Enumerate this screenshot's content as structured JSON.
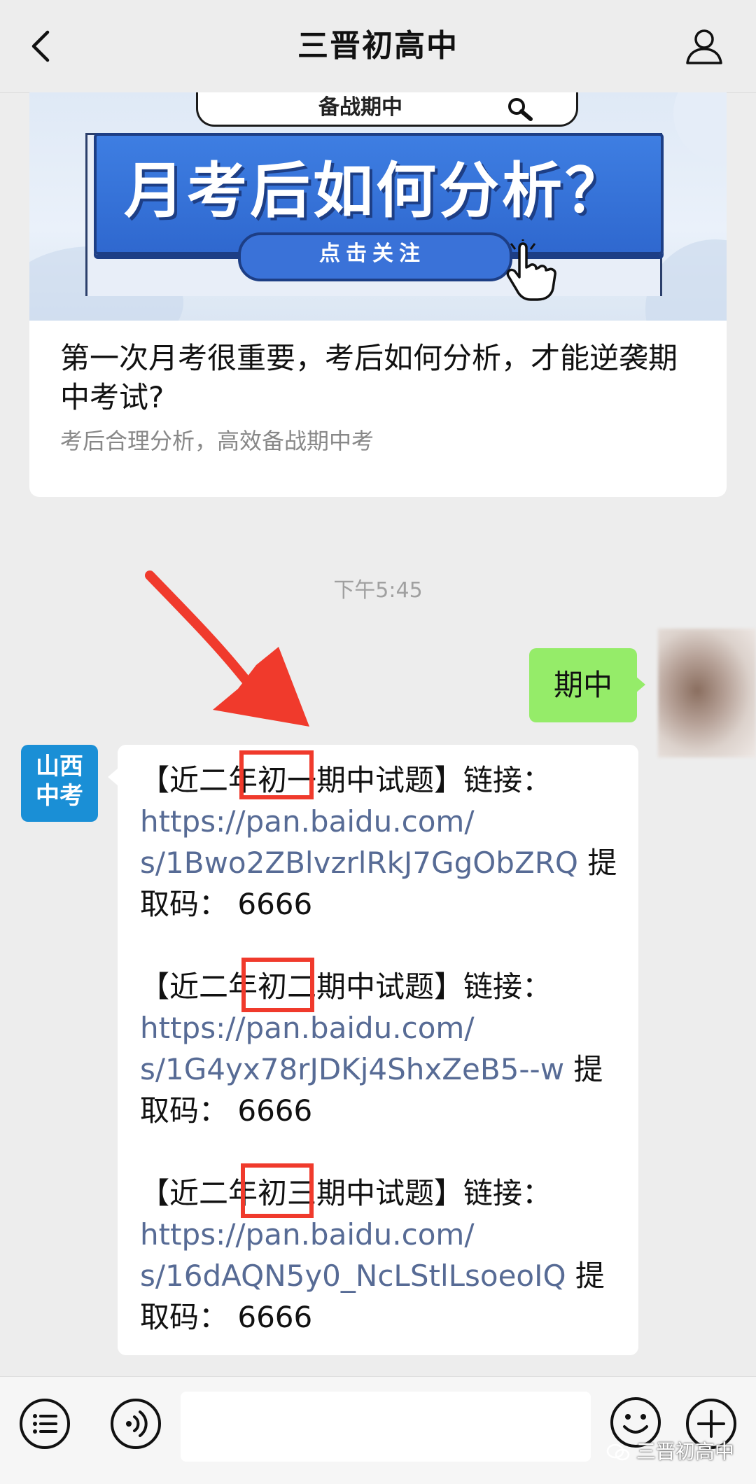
{
  "header": {
    "title": "三晋初高中",
    "back_icon": "chevron-left-icon",
    "profile_icon": "user-icon"
  },
  "article": {
    "banner": {
      "search_text": "备战期中",
      "headline": "月考后如何分析？",
      "follow_button": "点击关注",
      "colors": {
        "headline_bg": "#3a72d8",
        "border": "#1d3e85"
      }
    },
    "title": "第一次月考很重要，考后如何分析，才能逆袭期中考试?",
    "subtitle": "考后合理分析，高效备战期中考"
  },
  "timestamp": "下午5:45",
  "sent_message": {
    "text": "期中",
    "bubble_color": "#95ec69"
  },
  "received_message": {
    "avatar_text_line1": "山西",
    "avatar_text_line2": "中考",
    "blocks": [
      {
        "prefix": "【近二年",
        "highlight": "初一",
        "suffix": "期中试题】链接：",
        "url_line1": "https://pan.baidu.com/",
        "url_line2": "s/1Bwo2ZBlvzrlRkJ7GgObZRQ",
        "after_url": " 提",
        "code_line": "取码：  6666"
      },
      {
        "prefix": "【近二年",
        "highlight": "初二",
        "suffix": "期中试题】链接：",
        "url_line1": "https://pan.baidu.com/",
        "url_line2": "s/1G4yx78rJDKj4ShxZeB5--w",
        "after_url": " 提",
        "code_line": "取码：  6666"
      },
      {
        "prefix": "【近二年",
        "highlight": "初三",
        "suffix": "期中试题】链接：",
        "url_line1": "https://pan.baidu.com/",
        "url_line2": "s/16dAQN5y0_NcLStlLsoeoIQ",
        "after_url": " 提",
        "code_line": "取码：  6666"
      }
    ],
    "link_color": "#576b95",
    "highlight_color": "#f03a2c"
  },
  "annotation": {
    "arrow_color": "#f03a2c"
  },
  "bottom_bar": {
    "menu_icon": "list-menu-icon",
    "voice_icon": "voice-icon",
    "emoji_icon": "emoji-icon",
    "plus_icon": "plus-icon",
    "input_value": ""
  },
  "watermark": "三晋初高中"
}
